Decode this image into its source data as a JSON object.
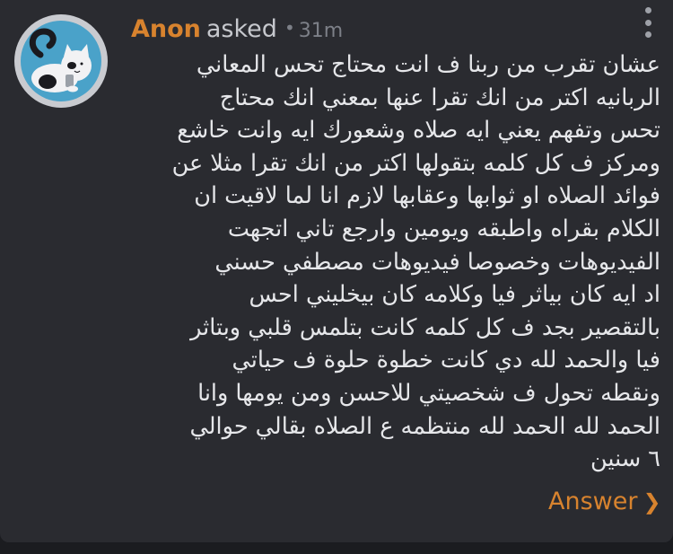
{
  "post": {
    "author": "Anon",
    "verb": "asked",
    "separator": "•",
    "time": "31m",
    "question": "عشان تقرب من ربنا ف انت محتاج تحس المعاني\nالربانيه اكتر من انك تقرا عنها بمعني انك محتاج\nتحس وتفهم يعني ايه صلاه وشعورك ايه وانت خاشع\nومركز ف كل كلمه بتقولها اكتر من انك تقرا مثلا عن\nفوائد الصلاه او ثوابها وعقابها لازم انا لما لاقيت ان\nالكلام بقراه واطبقه ويومين وارجع تاني اتجهت\nالفيديوهات وخصوصا فيديوهات مصطفي حسني\nاد ايه كان بياثر فيا وكلامه كان بيخليني احس\nبالتقصير بجد ف كل كلمه كانت بتلمس قلبي وبتاثر\nفيا والحمد لله دي كانت خطوة حلوة ف حياتي\nونقطه تحول ف شخصيتي للاحسن ومن يومها وانا\nالحمد لله الحمد لله منتظمه ع الصلاه بقالي حوالي\n٦ سنين",
    "answer_label": "Answer",
    "answer_chevron": "❯"
  },
  "colors": {
    "accent": "#d8832e",
    "card_background": "#2a2b30",
    "page_background": "#1b1c20",
    "text": "#e6e7ea",
    "muted": "#7d8088"
  },
  "icons": {
    "avatar": "cat-avatar-icon",
    "menu": "more-vertical-icon",
    "answer": "chevron-right-icon"
  }
}
